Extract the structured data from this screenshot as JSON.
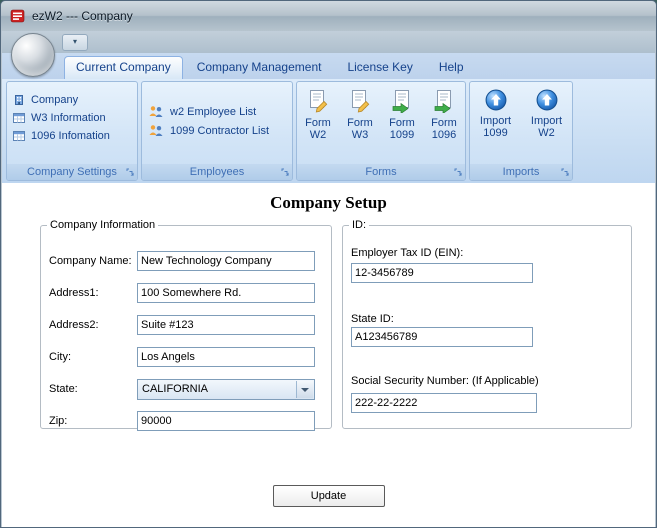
{
  "window": {
    "title": "ezW2 --- Company"
  },
  "ribbon": {
    "tabs": [
      {
        "label": "Current Company",
        "selected": true
      },
      {
        "label": "Company Management",
        "selected": false
      },
      {
        "label": "License Key",
        "selected": false
      },
      {
        "label": "Help",
        "selected": false
      }
    ],
    "groups": [
      {
        "label": "Company Settings",
        "items": [
          "Company",
          "W3 Information",
          "1096 Infomation"
        ]
      },
      {
        "label": "Employees",
        "items": [
          "w2 Employee List",
          "1099 Contractor List"
        ]
      },
      {
        "label": "Forms",
        "items": [
          {
            "top": "Form",
            "bottom": "W2"
          },
          {
            "top": "Form",
            "bottom": "W3"
          },
          {
            "top": "Form",
            "bottom": "1099"
          },
          {
            "top": "Form",
            "bottom": "1096"
          }
        ]
      },
      {
        "label": "Imports",
        "items": [
          {
            "top": "Import",
            "bottom": "1099"
          },
          {
            "top": "Import",
            "bottom": "W2"
          }
        ]
      }
    ]
  },
  "content": {
    "heading": "Company Setup",
    "company_info": {
      "legend": "Company Information",
      "fields": [
        {
          "label": "Company Name:",
          "value": "New Technology Company"
        },
        {
          "label": "Address1:",
          "value": "100 Somewhere Rd."
        },
        {
          "label": "Address2:",
          "value": "Suite #123"
        },
        {
          "label": "City:",
          "value": "Los Angels"
        },
        {
          "label": "State:",
          "value": "CALIFORNIA"
        },
        {
          "label": "Zip:",
          "value": "90000"
        }
      ]
    },
    "ids": {
      "legend": "ID:",
      "fields": [
        {
          "label": "Employer Tax ID (EIN):",
          "value": "12-3456789"
        },
        {
          "label": "State ID:",
          "value": "A123456789"
        },
        {
          "label": "Social Security Number: (If Applicable)",
          "value": "222-22-2222"
        }
      ]
    },
    "update_button": "Update"
  },
  "colors": {
    "ribbon_text": "#15428b",
    "group_label_text": "#3f6fb5",
    "ribbon_background": "#cfe1f4",
    "titlebar": "#b0bfca",
    "input_border": "#7f9db9",
    "app_icon_red": "#cc2222",
    "import_orb_blue": "#3f8fe0",
    "form_arrow_green": "#3fae49"
  },
  "icons": {
    "app_icon": "red-striped-document",
    "qat_dropdown_icon": "chevron-down",
    "company_icon": "blue-building",
    "w3_information_icon": "spreadsheet-grid",
    "info_1096_icon": "spreadsheet-grid",
    "w2_employee_list_icon": "two-people",
    "contractor_list_icon": "two-people",
    "form_w2_icon": "document-with-pencil",
    "form_w3_icon": "document-with-pencil",
    "form_1099_icon": "document-with-green-arrow",
    "form_1096_icon": "document-with-green-arrow",
    "import_1099_icon": "blue-orb-up-arrow",
    "import_w2_icon": "blue-orb-up-arrow",
    "dialog_launcher_icon": "corner-arrow",
    "state_dropdown_icon": "triangle-down"
  }
}
